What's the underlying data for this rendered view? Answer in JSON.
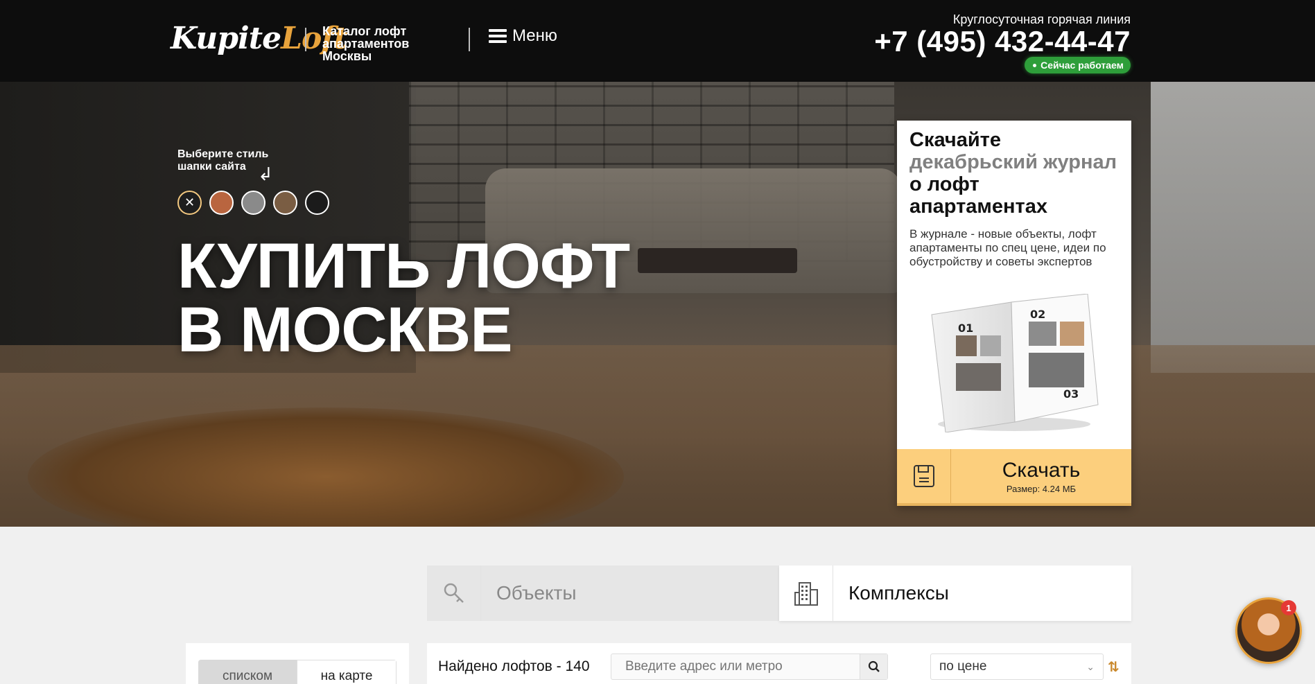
{
  "header": {
    "logo_part1": "Kupite",
    "logo_part2": "Loft",
    "catalog_text": "Каталог лофт апартаментов Москвы",
    "menu_label": "Меню",
    "hotline_label": "Круглосуточная горячая линия",
    "phone": "+7 (495) 432-44-47",
    "status": "Сейчас работаем"
  },
  "hero": {
    "style_label": "Выберите стиль шапки сайта",
    "swatches": [
      "none",
      "brick",
      "concrete",
      "wood",
      "dark"
    ],
    "title": "КУПИТЬ ЛОФТ В МОСКВЕ"
  },
  "journal": {
    "title_1": "Скачайте ",
    "title_2": "декабрьский журнал",
    "title_3": " о лофт апартаментах",
    "description": "В журнале - новые объекты, лофт апартаменты по спец цене, идеи по обустройству и советы экспертов",
    "download_label": "Скачать",
    "size_label": "Размер: 4.24 МБ"
  },
  "tabs": {
    "objects": "Объекты",
    "complexes": "Комплексы"
  },
  "view_toggle": {
    "list": "списком",
    "map": "на карте"
  },
  "results": {
    "found": "Найдено лофтов - 140",
    "search_placeholder": "Введите адрес или метро",
    "sort_value": "по цене"
  },
  "chat": {
    "badge": "1"
  },
  "colors": {
    "accent": "#e8a33c",
    "download_bg": "#fccf7d",
    "status_green": "#2e9e3a",
    "header_bg": "#0d0d0d"
  }
}
